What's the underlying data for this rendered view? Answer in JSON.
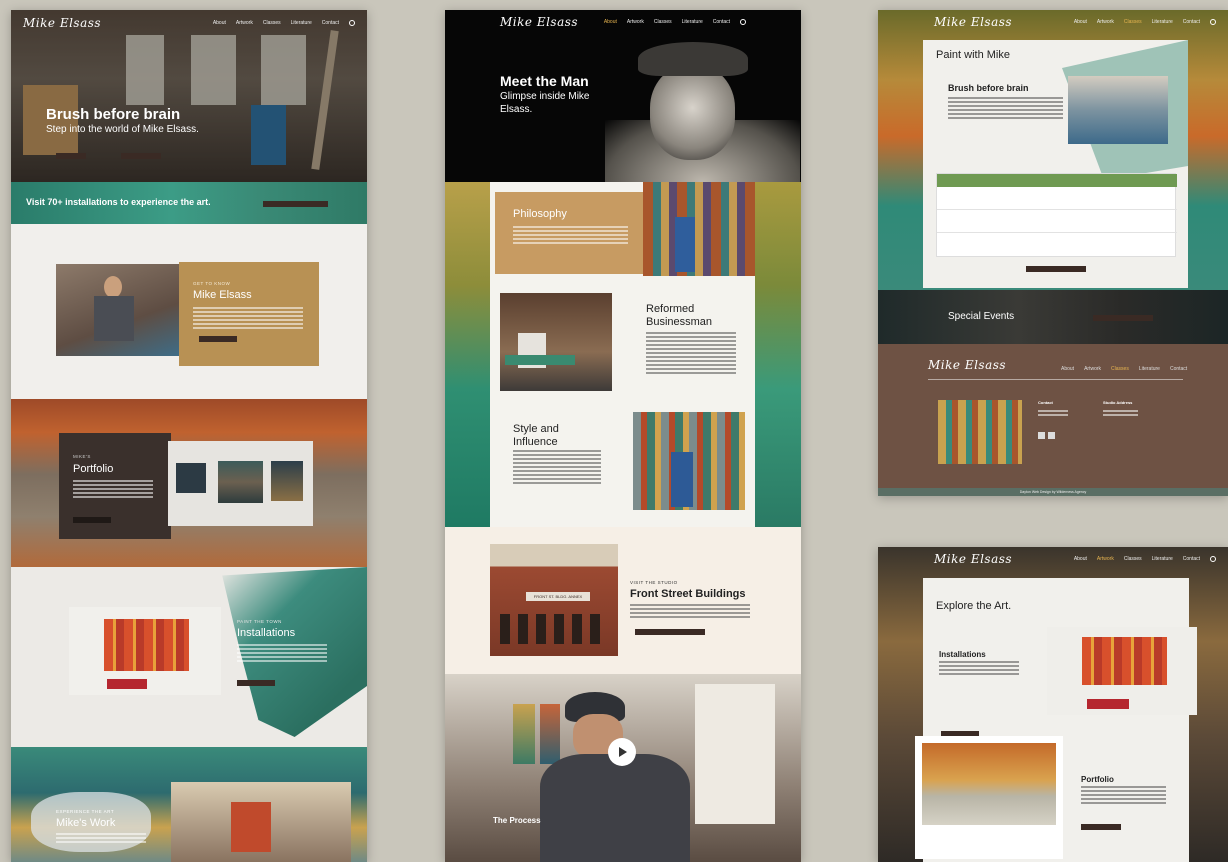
{
  "site": {
    "logo": "Mike Elsass"
  },
  "nav": {
    "items": [
      "About",
      "Artwork",
      "Classes",
      "Literature",
      "Contact"
    ]
  },
  "left": {
    "hero_title": "Brush before brain",
    "hero_subtitle": "Step into the world of Mike Elsass.",
    "banner_text": "Visit 70+ installations to experience the art.",
    "about": {
      "eyebrow": "GET TO KNOW",
      "title": "Mike Elsass"
    },
    "portfolio": {
      "eyebrow": "MIKE'S",
      "title": "Portfolio"
    },
    "installations": {
      "eyebrow": "PAINT THE TOWN",
      "title": "Installations"
    },
    "work": {
      "eyebrow": "EXPERIENCE THE ART",
      "title": "Mike's Work"
    }
  },
  "center": {
    "hero_title": "Meet the Man",
    "hero_subtitle": "Glimpse inside Mike Elsass.",
    "philosophy": "Philosophy",
    "reformed": "Reformed Businessman",
    "style": "Style and Influence",
    "studio_eyebrow": "VISIT THE STUDIO",
    "studio_title": "Front Street Buildings",
    "process": "The Process",
    "building_sign": "FRONT ST. BLDG. ANNEX"
  },
  "right_top": {
    "title": "Paint with Mike",
    "card_title": "Brush before brain",
    "special_events": "Special Events",
    "footer_contact": "Contact",
    "footer_studio": "Studio Address",
    "credit": "Dayton Web Design by Wilderness Agency"
  },
  "right_bottom": {
    "title": "Explore the Art.",
    "installations": "Installations",
    "portfolio": "Portfolio"
  },
  "colors": {
    "teal": "#2f8a78",
    "ochre": "#c99a45",
    "brown": "#6b4f42",
    "rust": "#b8562b",
    "gold_accent": "#e6b450"
  }
}
